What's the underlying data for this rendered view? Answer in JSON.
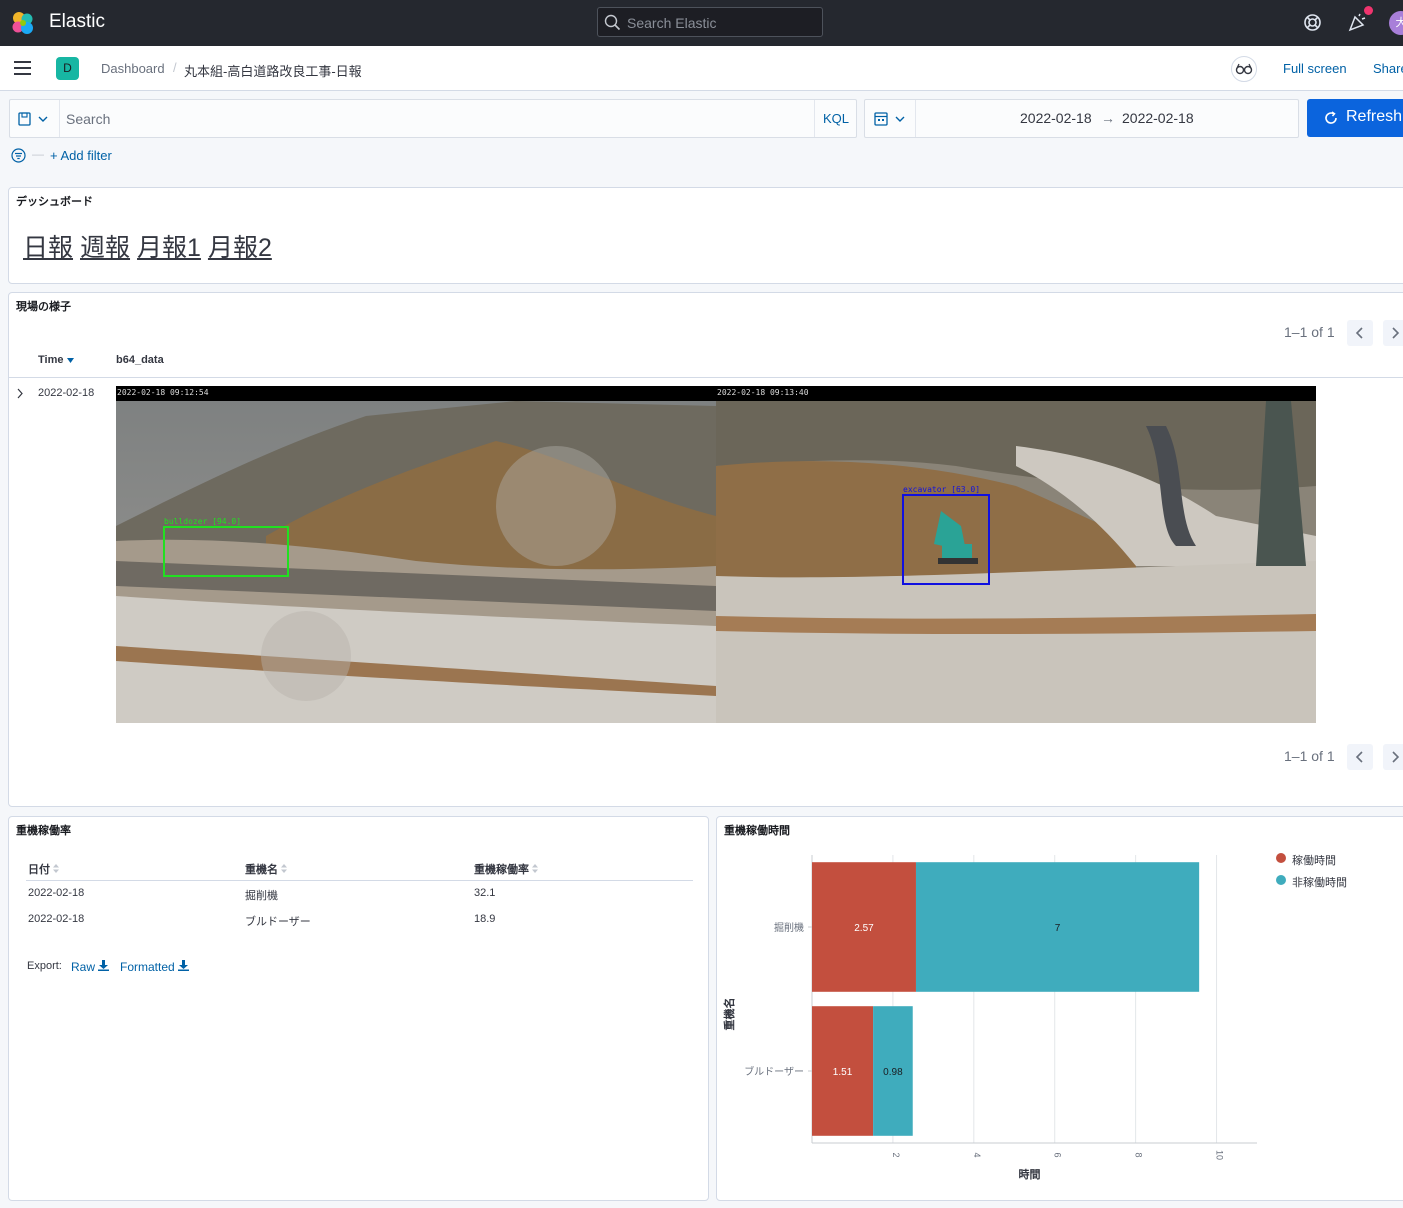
{
  "header": {
    "brand": "Elastic",
    "search_placeholder": "Search Elastic",
    "avatar_initial": "大"
  },
  "breadcrumbs": {
    "space_badge": "D",
    "items": [
      "Dashboard",
      "丸本組-高白道路改良工事-日報"
    ],
    "separator": "/"
  },
  "actions": {
    "full_screen": "Full screen",
    "share": "Share"
  },
  "query": {
    "placeholder": "Search",
    "language": "KQL",
    "date_start": "2022-02-18",
    "date_end": "2022-02-18",
    "arrow": "→",
    "refresh": "Refresh",
    "add_filter": "+ Add filter",
    "filter_dash": "—"
  },
  "panel_nav": {
    "title": "デッシュボード",
    "links": [
      "日報",
      "週報",
      "月報1",
      "月報2"
    ]
  },
  "panel_site": {
    "title": "現場の様子",
    "pager": "1–1 of 1",
    "col_time": "Time",
    "col_b64": "b64_data",
    "row_date": "2022-02-18",
    "cam1_stamp": "2022-02-18  09:12:54",
    "cam2_stamp": "2022-02-18  09:13:40",
    "cam1_box_label": "bulldozer [94.0]",
    "cam2_box_label": "excavator [63.0]"
  },
  "panel_rate": {
    "title": "重機稼働率",
    "columns": [
      "日付",
      "重機名",
      "重機稼働率"
    ],
    "rows": [
      [
        "2022-02-18",
        "掘削機",
        "32.1"
      ],
      [
        "2022-02-18",
        "ブルドーザー",
        "18.9"
      ]
    ],
    "export_label": "Export:",
    "export_raw": "Raw",
    "export_formatted": "Formatted"
  },
  "panel_hours": {
    "title": "重機稼働時間"
  },
  "colors": {
    "series_on": "#c34f3e",
    "series_off": "#3facbd",
    "accent": "#0b64dd"
  },
  "chart_data": {
    "type": "bar",
    "orientation": "horizontal",
    "stacked": true,
    "categories": [
      "掘削機",
      "ブルドーザー"
    ],
    "series": [
      {
        "name": "稼働時間",
        "values": [
          2.57,
          1.51
        ]
      },
      {
        "name": "非稼働時間",
        "values": [
          7,
          0.98
        ]
      }
    ],
    "xlabel": "時間",
    "ylabel": "重機名",
    "xlim": [
      0,
      11
    ],
    "xticks": [
      2,
      4,
      6,
      8,
      10
    ],
    "legend_position": "top-right",
    "grid": true
  }
}
